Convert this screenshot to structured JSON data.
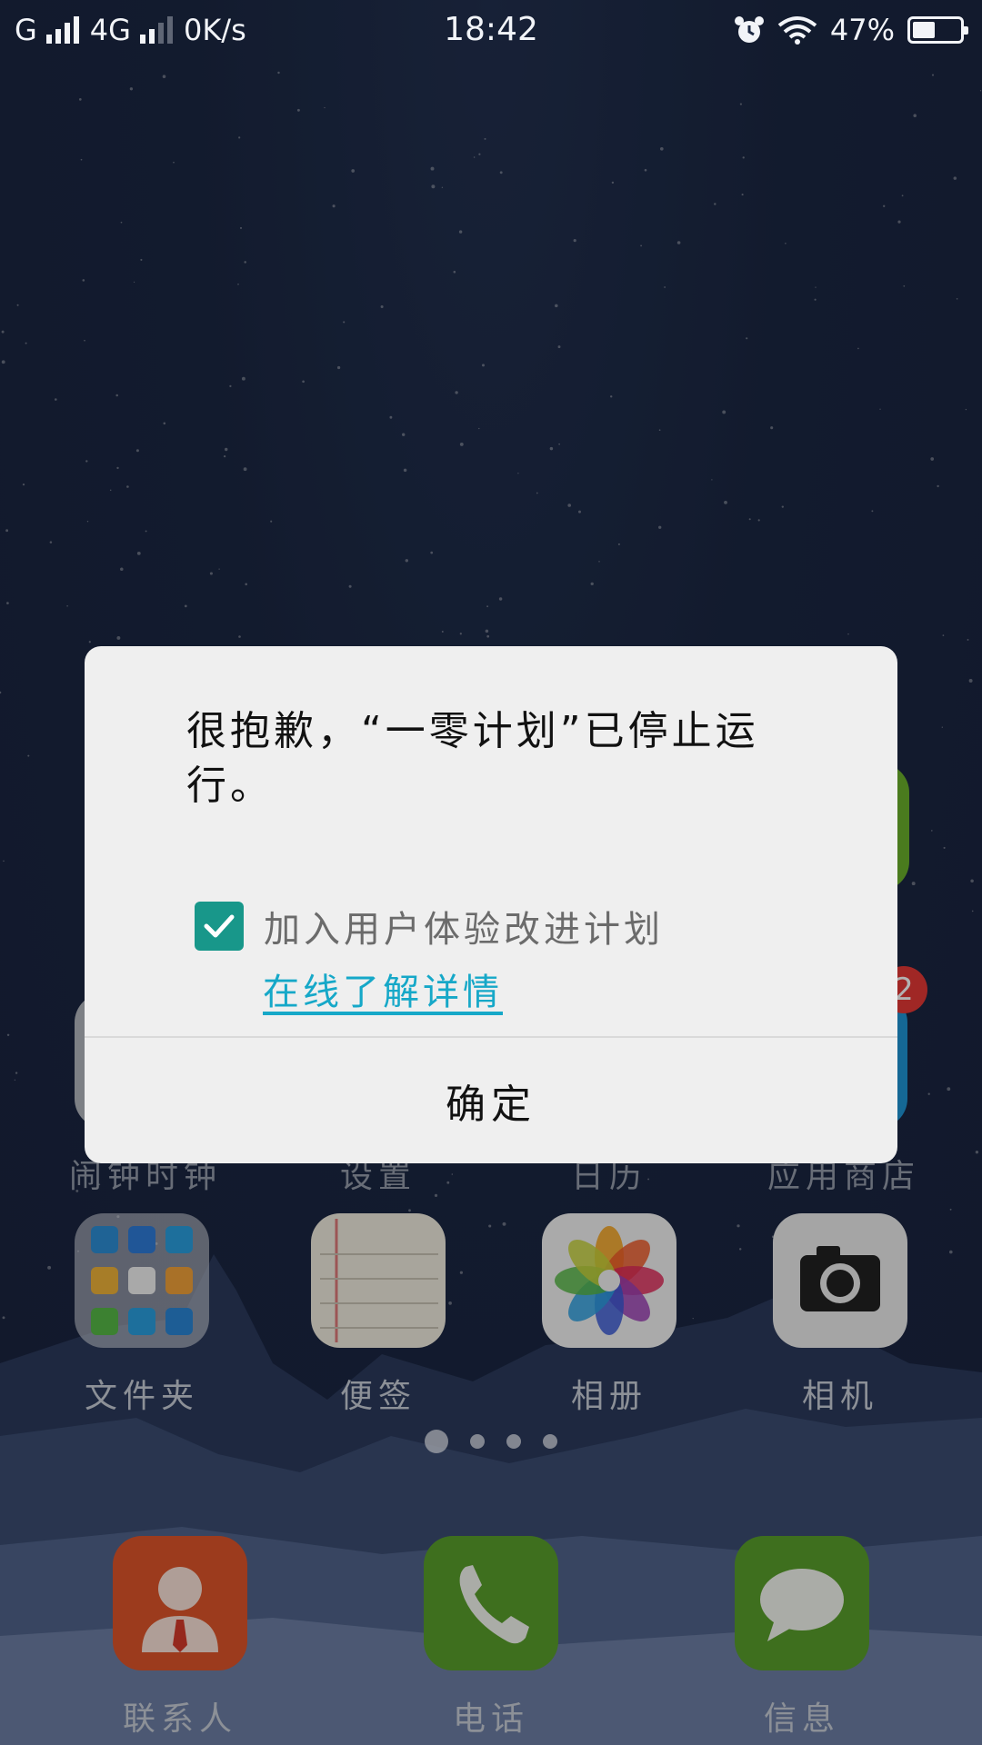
{
  "status_bar": {
    "carrier1": "G",
    "network": "4G",
    "speed": "0K/s",
    "time": "18:42",
    "battery_percent": "47%",
    "battery_level": 0.47,
    "icons": [
      "signal-icon",
      "alarm-icon",
      "wifi-icon",
      "battery-icon"
    ]
  },
  "home": {
    "hidden_row": [
      {
        "label": "闹钟时钟"
      },
      {
        "label": "设置"
      },
      {
        "label": "日历"
      },
      {
        "label": "应用商店",
        "badge": "2"
      }
    ],
    "apps": [
      {
        "label": "文件夹",
        "icon": "folder-icon"
      },
      {
        "label": "便签",
        "icon": "notes-icon"
      },
      {
        "label": "相册",
        "icon": "photos-icon"
      },
      {
        "label": "相机",
        "icon": "camera-icon"
      }
    ],
    "page_dots": 4,
    "active_page": 1,
    "dock": [
      {
        "label": "联系人",
        "icon": "contacts-icon",
        "color": "#e0552a"
      },
      {
        "label": "电话",
        "icon": "phone-icon",
        "color": "#5aa02c"
      },
      {
        "label": "信息",
        "icon": "message-icon",
        "color": "#5aa02c"
      }
    ]
  },
  "dialog": {
    "message": "很抱歉，“一零计划”已停止运行。",
    "checkbox_label": "加入用户体验改进计划",
    "checkbox_checked": true,
    "link_text": "在线了解详情",
    "confirm_button": "确定",
    "accent": "#18978a",
    "link_color": "#16a8c8"
  }
}
